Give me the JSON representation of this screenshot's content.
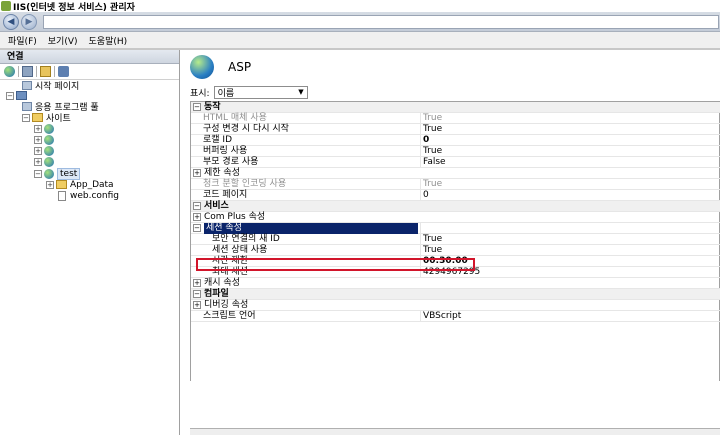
{
  "window": {
    "title": "IIS(인터넷 정보 서비스) 관리자"
  },
  "nav": {
    "back_glyph": "◀",
    "forward_glyph": "▶"
  },
  "menu": [
    "파일(F)",
    "보기(V)",
    "도움말(H)"
  ],
  "left_pane": {
    "header": "연결",
    "tree": {
      "start_page": "시작 페이지",
      "app_pools": "응용 프로그램 풀",
      "sites": "사이트",
      "selected_site": "test",
      "app_data": "App_Data",
      "web_config": "web.config"
    }
  },
  "right_pane": {
    "title": "ASP",
    "filter_label": "표시:",
    "filter_value": "이름",
    "rows": [
      {
        "kind": "cat",
        "name": "동작"
      },
      {
        "kind": "prop",
        "name": "HTML 매체 사용",
        "value": "True",
        "disabled": true
      },
      {
        "kind": "prop",
        "name": "구성 변경 시 다시 시작",
        "value": "True"
      },
      {
        "kind": "prop",
        "name": "로캘 ID",
        "value": "0",
        "bold": true
      },
      {
        "kind": "prop",
        "name": "버퍼링 사용",
        "value": "True"
      },
      {
        "kind": "prop",
        "name": "부모 경로 사용",
        "value": "False"
      },
      {
        "kind": "sub",
        "name": "제한 속성"
      },
      {
        "kind": "prop",
        "name": "청크 분할 인코딩 사용",
        "value": "True",
        "disabled": true
      },
      {
        "kind": "prop",
        "name": "코드 페이지",
        "value": "0"
      },
      {
        "kind": "cat",
        "name": "서비스"
      },
      {
        "kind": "sub",
        "name": "Com Plus 속성"
      },
      {
        "kind": "selected",
        "name": "세션 속성"
      },
      {
        "kind": "prop2",
        "name": "보안 연결의 새 ID",
        "value": "True"
      },
      {
        "kind": "prop2",
        "name": "세션 상태 사용",
        "value": "True"
      },
      {
        "kind": "prop2",
        "name": "시간 제한",
        "value": "00:30:00",
        "bold": true
      },
      {
        "kind": "prop2",
        "name": "최대 세션",
        "value": "4294967295"
      },
      {
        "kind": "sub",
        "name": "캐시 속성"
      },
      {
        "kind": "cat",
        "name": "컴파일"
      },
      {
        "kind": "sub",
        "name": "디버깅 속성"
      },
      {
        "kind": "prop",
        "name": "스크립트 언어",
        "value": "VBScript"
      }
    ]
  },
  "colors": {
    "highlight_border": "#d2152b",
    "selection": "#0a246a"
  }
}
